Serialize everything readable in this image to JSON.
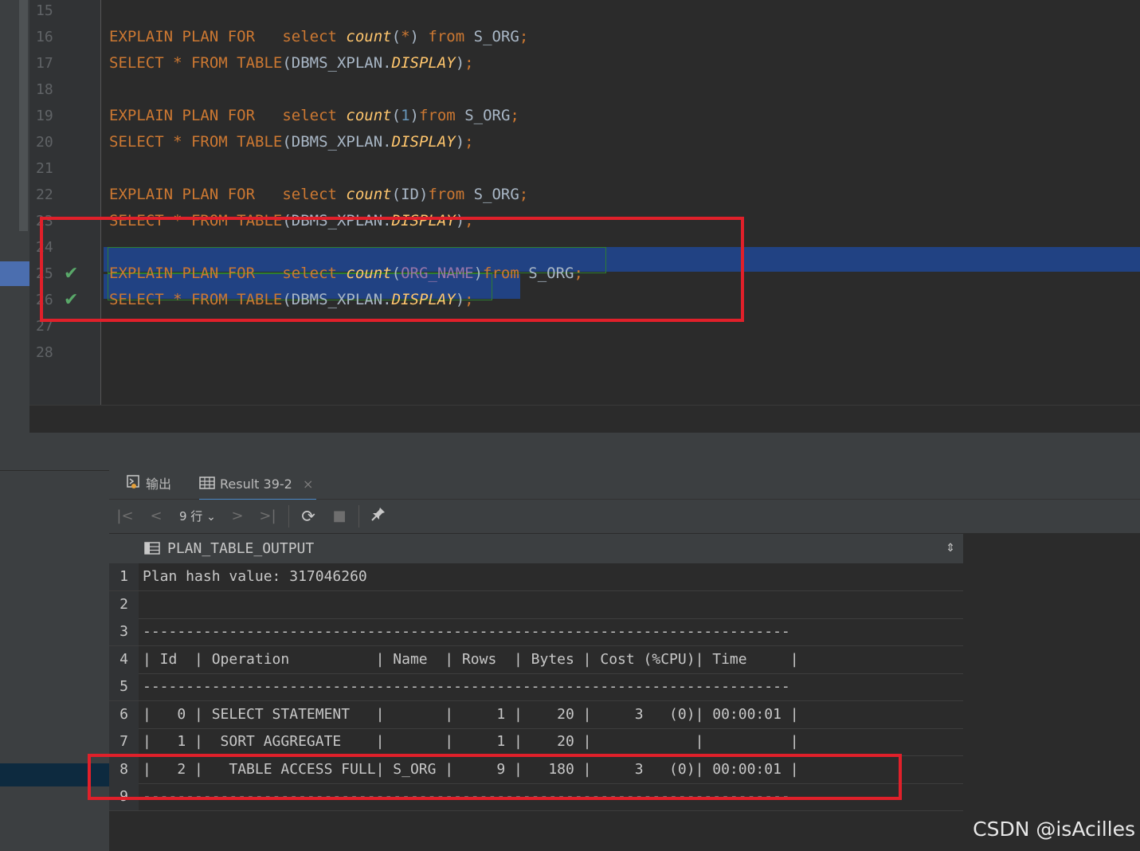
{
  "editor": {
    "lines": [
      {
        "n": "15",
        "html": ""
      },
      {
        "n": "16",
        "html": "<span class=\"kw\">EXPLAIN PLAN FOR   select </span><span class=\"fn\">count</span>(<span class=\"kw\">*</span>) <span class=\"kw\">from</span> S_ORG<span class=\"kw\">;</span>"
      },
      {
        "n": "17",
        "html": "<span class=\"kw\">SELECT * FROM TABLE</span>(DBMS_XPLAN.<span class=\"fn\">DISPLAY</span>)<span class=\"kw\">;</span>"
      },
      {
        "n": "18",
        "html": ""
      },
      {
        "n": "19",
        "html": "<span class=\"kw\">EXPLAIN PLAN FOR   select </span><span class=\"fn\">count</span>(<span class=\"num\">1</span>)<span class=\"kw\">from</span> S_ORG<span class=\"kw\">;</span>"
      },
      {
        "n": "20",
        "html": "<span class=\"kw\">SELECT * FROM TABLE</span>(DBMS_XPLAN.<span class=\"fn\">DISPLAY</span>)<span class=\"kw\">;</span>"
      },
      {
        "n": "21",
        "html": ""
      },
      {
        "n": "22",
        "html": "<span class=\"kw\">EXPLAIN PLAN FOR   select </span><span class=\"fn\">count</span>(ID)<span class=\"kw\">from</span> S_ORG<span class=\"kw\">;</span>"
      },
      {
        "n": "23",
        "html": "<span class=\"kw\">SELECT * FROM TABLE</span>(DBMS_XPLAN.<span class=\"fn\">DISPLAY</span>)<span class=\"kw\">;</span>"
      },
      {
        "n": "24",
        "html": ""
      },
      {
        "n": "25",
        "html": "<span class=\"kw\">EXPLAIN PLAN FOR   select </span><span class=\"fn\">count</span>(<span class=\"col\">ORG_NAME</span>)<span class=\"kw\">from</span> S_ORG<span class=\"kw\">;</span>",
        "check": true
      },
      {
        "n": "26",
        "html": "<span class=\"kw\">SELECT * FROM TABLE</span>(DBMS_XPLAN.<span class=\"fn\">DISPLAY</span>)<span class=\"kw\">;</span>",
        "check": true
      },
      {
        "n": "27",
        "html": ""
      },
      {
        "n": "28",
        "html": ""
      }
    ]
  },
  "output_panel": {
    "tabs": [
      {
        "label": "输出",
        "icon": "console-icon"
      },
      {
        "label": "Result 39-2",
        "icon": "table-icon",
        "close": "×"
      }
    ],
    "toolbar": {
      "rows_label": "9 行",
      "rows_chevron": "⌄",
      "first": "|<",
      "prev": "<",
      "next": ">",
      "last": ">|",
      "refresh": "⟳",
      "stop": "■",
      "pin": "📌"
    },
    "column_header": "PLAN_TABLE_OUTPUT",
    "sort_icon": "⇕",
    "rows": [
      {
        "n": "1",
        "text": "Plan hash value: 317046260"
      },
      {
        "n": "2",
        "text": ""
      },
      {
        "n": "3",
        "text": "---------------------------------------------------------------------------"
      },
      {
        "n": "4",
        "text": "| Id  | Operation          | Name  | Rows  | Bytes | Cost (%CPU)| Time     |"
      },
      {
        "n": "5",
        "text": "---------------------------------------------------------------------------"
      },
      {
        "n": "6",
        "text": "|   0 | SELECT STATEMENT   |       |     1 |    20 |     3   (0)| 00:00:01 |"
      },
      {
        "n": "7",
        "text": "|   1 |  SORT AGGREGATE    |       |     1 |    20 |            |          |"
      },
      {
        "n": "8",
        "text": "|   2 |   TABLE ACCESS FULL| S_ORG |     9 |   180 |     3   (0)| 00:00:01 |"
      },
      {
        "n": "9",
        "text": "---------------------------------------------------------------------------"
      }
    ]
  },
  "watermark": "CSDN @isAcilles"
}
